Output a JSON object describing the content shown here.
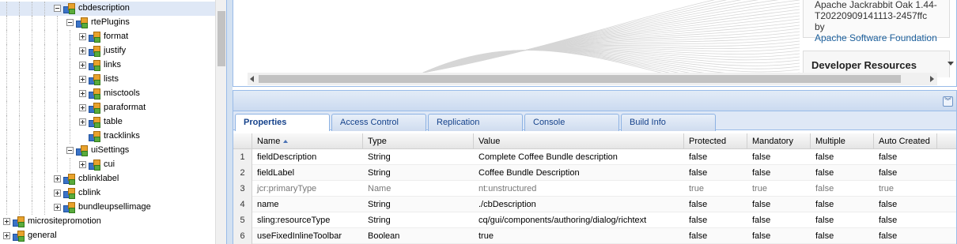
{
  "tree": {
    "nodes": [
      {
        "label": "cbdescription",
        "depth": 4,
        "toggle": "minus",
        "selected": true
      },
      {
        "label": "rtePlugins",
        "depth": 5,
        "toggle": "minus"
      },
      {
        "label": "format",
        "depth": 6,
        "toggle": "plus"
      },
      {
        "label": "justify",
        "depth": 6,
        "toggle": "plus"
      },
      {
        "label": "links",
        "depth": 6,
        "toggle": "plus"
      },
      {
        "label": "lists",
        "depth": 6,
        "toggle": "plus"
      },
      {
        "label": "misctools",
        "depth": 6,
        "toggle": "plus"
      },
      {
        "label": "paraformat",
        "depth": 6,
        "toggle": "plus"
      },
      {
        "label": "table",
        "depth": 6,
        "toggle": "plus"
      },
      {
        "label": "tracklinks",
        "depth": 6,
        "toggle": "none"
      },
      {
        "label": "uiSettings",
        "depth": 5,
        "toggle": "minus"
      },
      {
        "label": "cui",
        "depth": 6,
        "toggle": "plus"
      },
      {
        "label": "cblinklabel",
        "depth": 4,
        "toggle": "plus"
      },
      {
        "label": "cblink",
        "depth": 4,
        "toggle": "plus"
      },
      {
        "label": "bundleupsellimage",
        "depth": 4,
        "toggle": "plus"
      },
      {
        "label": "micrositepromotion",
        "depth": 0,
        "toggle": "plus"
      },
      {
        "label": "general",
        "depth": 0,
        "toggle": "plus"
      }
    ]
  },
  "info": {
    "line1": "Apache Jackrabbit Oak 1.44-",
    "line2": "T20220909141113-2457ffc by",
    "link": "Apache Software Foundation"
  },
  "developer_resources": "Developer Resources",
  "tabs": [
    {
      "label": "Properties",
      "active": true
    },
    {
      "label": "Access Control"
    },
    {
      "label": "Replication"
    },
    {
      "label": "Console"
    },
    {
      "label": "Build Info"
    }
  ],
  "grid": {
    "columns": [
      "Name",
      "Type",
      "Value",
      "Protected",
      "Mandatory",
      "Multiple",
      "Auto Created"
    ],
    "rows": [
      {
        "num": "1",
        "cells": [
          "fieldDescription",
          "String",
          "Complete Coffee Bundle description",
          "false",
          "false",
          "false",
          "false"
        ],
        "dim": false
      },
      {
        "num": "2",
        "cells": [
          "fieldLabel",
          "String",
          "Coffee Bundle Description",
          "false",
          "false",
          "false",
          "false"
        ],
        "dim": false
      },
      {
        "num": "3",
        "cells": [
          "jcr:primaryType",
          "Name",
          "nt:unstructured",
          "true",
          "true",
          "false",
          "true"
        ],
        "dim": true
      },
      {
        "num": "4",
        "cells": [
          "name",
          "String",
          "./cbDescription",
          "false",
          "false",
          "false",
          "false"
        ],
        "dim": false
      },
      {
        "num": "5",
        "cells": [
          "sling:resourceType",
          "String",
          "cq/gui/components/authoring/dialog/richtext",
          "false",
          "false",
          "false",
          "false"
        ],
        "dim": false
      },
      {
        "num": "6",
        "cells": [
          "useFixedInlineToolbar",
          "Boolean",
          "true",
          "false",
          "false",
          "false",
          "false"
        ],
        "dim": false
      }
    ]
  }
}
